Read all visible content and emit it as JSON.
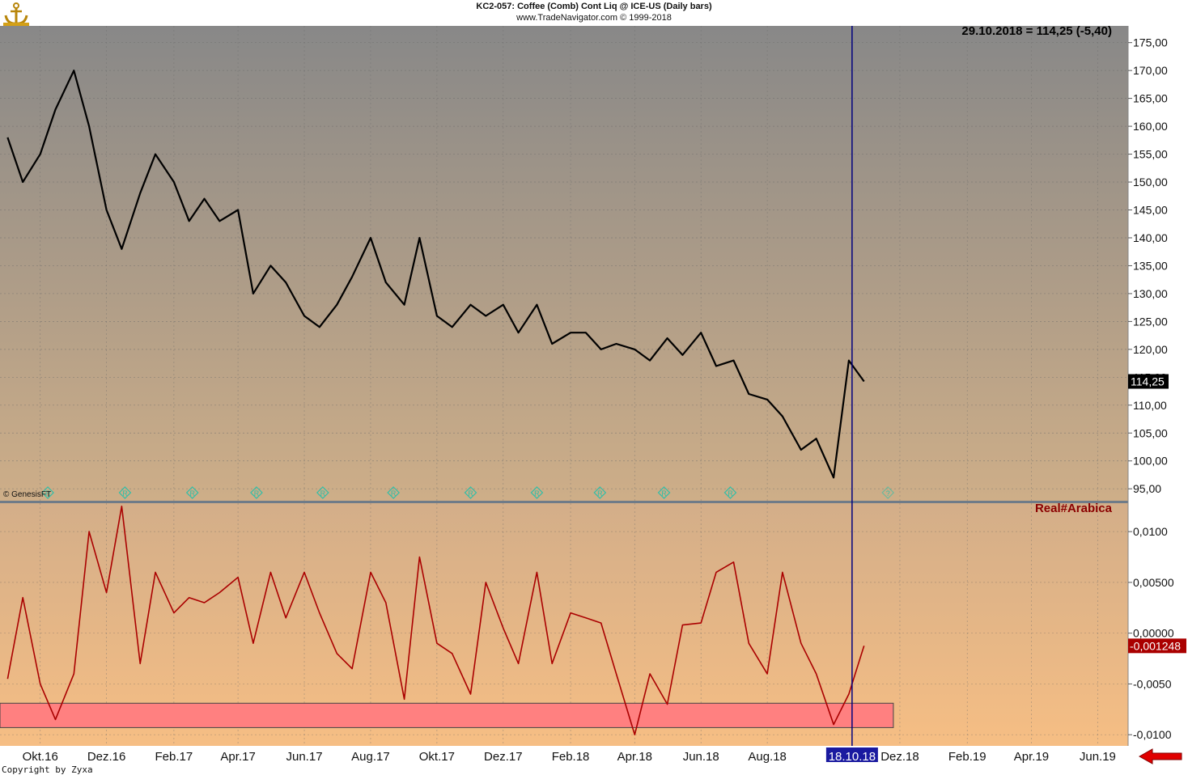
{
  "header": {
    "line1": "KC2-057:  Coffee (Comb) Cont Liq @ ICE-US  (Daily bars)",
    "line2": "www.TradeNavigator.com © 1999-2018"
  },
  "quote_label": "29.10.2018 = 114,25 (-5,40)",
  "genesis_label": "© GenesisFT",
  "copyright": "Copyright by Zyxa",
  "icons": {
    "logo": "anchor-logo-icon",
    "arrow": "red-left-arrow-icon",
    "marker": "r-diamond-icon"
  },
  "colors": {
    "price_panel_top": "#888888",
    "price_panel_bottom": "#ceae88",
    "indicator_panel_top": "#d3ae89",
    "indicator_panel_bottom": "#f6be84",
    "price_line": "#000000",
    "indicator_line": "#aa0000",
    "cursor_line": "#00007f",
    "zone_fill": "#ff8080",
    "marker": "#2fbfa8"
  },
  "chart_data": [
    {
      "type": "line",
      "title": "KC2-057:  Coffee (Comb) Cont Liq @ ICE-US  (Daily bars)",
      "y_tick_labels": [
        "95,00",
        "100,00",
        "105,00",
        "110,00",
        "115,00",
        "120,00",
        "125,00",
        "130,00",
        "135,00",
        "140,00",
        "145,00",
        "150,00",
        "155,00",
        "160,00",
        "165,00",
        "170,00",
        "175,00"
      ],
      "ylim": [
        93.0,
        178.0
      ],
      "last_value_label": "114,25",
      "grid": true,
      "x": [
        "2016-09-01",
        "2016-09-15",
        "2016-10-01",
        "2016-10-15",
        "2016-11-01",
        "2016-11-15",
        "2016-12-01",
        "2016-12-15",
        "2017-01-01",
        "2017-01-15",
        "2017-02-01",
        "2017-02-15",
        "2017-03-01",
        "2017-03-15",
        "2017-04-01",
        "2017-04-15",
        "2017-05-01",
        "2017-05-15",
        "2017-06-01",
        "2017-06-15",
        "2017-07-01",
        "2017-07-15",
        "2017-08-01",
        "2017-08-15",
        "2017-09-01",
        "2017-09-15",
        "2017-10-01",
        "2017-10-15",
        "2017-11-01",
        "2017-11-15",
        "2017-12-01",
        "2017-12-15",
        "2018-01-01",
        "2018-01-15",
        "2018-02-01",
        "2018-02-15",
        "2018-03-01",
        "2018-03-15",
        "2018-04-01",
        "2018-04-15",
        "2018-05-01",
        "2018-05-15",
        "2018-06-01",
        "2018-06-15",
        "2018-07-01",
        "2018-07-15",
        "2018-08-01",
        "2018-08-15",
        "2018-09-01",
        "2018-09-15",
        "2018-10-01",
        "2018-10-15",
        "2018-10-29"
      ],
      "y": [
        158,
        150,
        155,
        163,
        170,
        160,
        145,
        138,
        148,
        155,
        150,
        143,
        147,
        143,
        145,
        130,
        135,
        132,
        126,
        124,
        128,
        133,
        140,
        132,
        128,
        140,
        126,
        124,
        128,
        126,
        128,
        123,
        128,
        121,
        123,
        123,
        120,
        121,
        120,
        118,
        122,
        119,
        123,
        117,
        118,
        112,
        111,
        108,
        102,
        104,
        97,
        118,
        114.25
      ]
    },
    {
      "type": "line",
      "title": "Real#Arabica",
      "y_tick_labels": [
        "-0,0100",
        "-0,0050",
        "0,00000",
        "0,00500",
        "0,0100"
      ],
      "ylim": [
        -0.0111,
        0.0128
      ],
      "last_value_label": "-0,001248",
      "grid": true,
      "x": [
        "2016-09-01",
        "2016-09-15",
        "2016-10-01",
        "2016-10-15",
        "2016-11-01",
        "2016-11-15",
        "2016-12-01",
        "2016-12-15",
        "2017-01-01",
        "2017-01-15",
        "2017-02-01",
        "2017-02-15",
        "2017-03-01",
        "2017-03-15",
        "2017-04-01",
        "2017-04-15",
        "2017-05-01",
        "2017-05-15",
        "2017-06-01",
        "2017-06-15",
        "2017-07-01",
        "2017-07-15",
        "2017-08-01",
        "2017-08-15",
        "2017-09-01",
        "2017-09-15",
        "2017-10-01",
        "2017-10-15",
        "2017-11-01",
        "2017-11-15",
        "2017-12-01",
        "2017-12-15",
        "2018-01-01",
        "2018-01-15",
        "2018-02-01",
        "2018-02-15",
        "2018-03-01",
        "2018-03-15",
        "2018-04-01",
        "2018-04-15",
        "2018-05-01",
        "2018-05-15",
        "2018-06-01",
        "2018-06-15",
        "2018-07-01",
        "2018-07-15",
        "2018-08-01",
        "2018-08-15",
        "2018-09-01",
        "2018-09-15",
        "2018-10-01",
        "2018-10-15",
        "2018-10-29"
      ],
      "y": [
        -0.0045,
        0.0035,
        -0.005,
        -0.0085,
        -0.004,
        0.01,
        0.004,
        0.0125,
        -0.003,
        0.006,
        0.002,
        0.0035,
        0.003,
        0.004,
        0.0055,
        -0.001,
        0.006,
        0.0015,
        0.006,
        0.002,
        -0.002,
        -0.0035,
        0.006,
        0.003,
        -0.0065,
        0.0075,
        -0.001,
        -0.002,
        -0.006,
        0.005,
        0.0005,
        -0.003,
        0.006,
        -0.003,
        0.002,
        0.0015,
        0.001,
        -0.004,
        -0.01,
        -0.004,
        -0.007,
        0.0008,
        0.001,
        0.006,
        0.007,
        -0.001,
        -0.004,
        0.006,
        -0.001,
        -0.004,
        -0.009,
        -0.006,
        -0.001248
      ]
    }
  ],
  "x_axis": {
    "labels": [
      "Okt.16",
      "Dez.16",
      "Feb.17",
      "Apr.17",
      "Jun.17",
      "Aug.17",
      "Okt.17",
      "Dez.17",
      "Feb.18",
      "Apr.18",
      "Jun.18",
      "Aug.18",
      "Dez.18",
      "Feb.19",
      "Apr.19",
      "Jun.19"
    ],
    "label_dates": [
      "2016-10-01",
      "2016-12-01",
      "2017-02-01",
      "2017-04-01",
      "2017-06-01",
      "2017-08-01",
      "2017-10-01",
      "2017-12-01",
      "2018-02-01",
      "2018-04-01",
      "2018-06-01",
      "2018-08-01",
      "2018-12-01",
      "2019-02-01",
      "2019-04-01",
      "2019-06-01"
    ],
    "range": [
      "2016-08-25",
      "2019-06-29"
    ],
    "highlight_label": "18.10.18",
    "highlight_date": "2018-10-18"
  },
  "cursor_date": "2018-10-18",
  "zone": {
    "y_from": -0.0093,
    "y_to": -0.0069,
    "x_from": "2016-08-25",
    "x_to": "2018-11-25"
  },
  "markers": {
    "glyph": "R",
    "dates": [
      "2016-10-08",
      "2016-12-18",
      "2017-02-18",
      "2017-04-18",
      "2017-06-18",
      "2017-08-22",
      "2017-11-01",
      "2018-01-01",
      "2018-02-28",
      "2018-04-28",
      "2018-06-28",
      "2018-11-20"
    ],
    "pending": [
      false,
      false,
      false,
      false,
      false,
      false,
      false,
      false,
      false,
      false,
      false,
      true
    ]
  }
}
